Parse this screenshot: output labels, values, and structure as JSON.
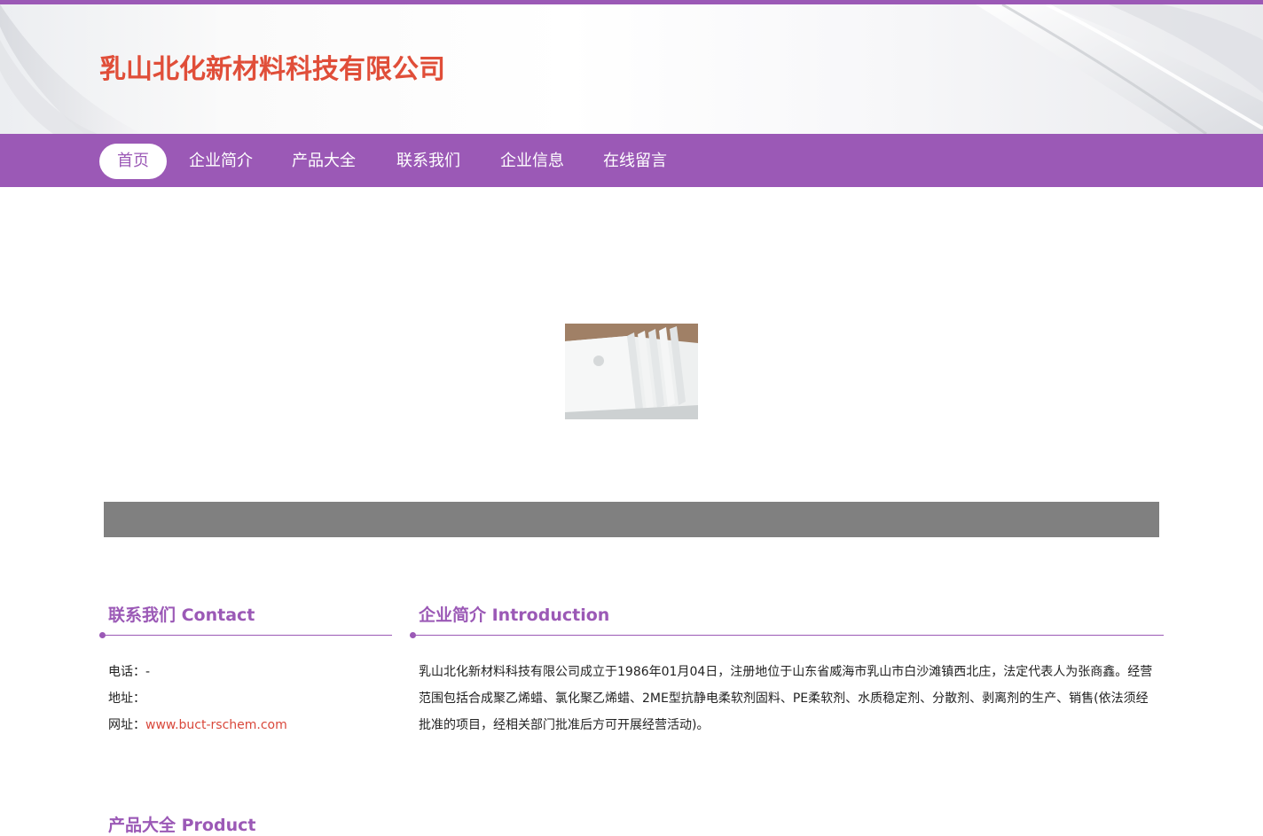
{
  "header": {
    "title": "乳山北化新材料科技有限公司"
  },
  "nav": {
    "items": [
      {
        "label": "首页",
        "active": true
      },
      {
        "label": "企业简介",
        "active": false
      },
      {
        "label": "产品大全",
        "active": false
      },
      {
        "label": "联系我们",
        "active": false
      },
      {
        "label": "企业信息",
        "active": false
      },
      {
        "label": "在线留言",
        "active": false
      }
    ]
  },
  "contact": {
    "title": "联系我们 Contact",
    "phone_label": "电话：",
    "phone_value": "-",
    "address_label": "地址：",
    "address_value": "",
    "website_label": "网址：",
    "website_value": "www.buct-rschem.com"
  },
  "intro": {
    "title": "企业简介 Introduction",
    "text": "乳山北化新材料科技有限公司成立于1986年01月04日，注册地位于山东省威海市乳山市白沙滩镇西北庄，法定代表人为张商鑫。经营范围包括合成聚乙烯蜡、氯化聚乙烯蜡、2ME型抗静电柔软剂固料、PE柔软剂、水质稳定剂、分散剂、剥离剂的生产、销售(依法须经批准的项目，经相关部门批准后方可开展经营活动)。"
  },
  "products": {
    "title": "产品大全 Product"
  },
  "colors": {
    "accent": "#9b59b6",
    "title_red": "#e04e39",
    "link_red": "#d9483b",
    "gray_bar": "#808080"
  }
}
